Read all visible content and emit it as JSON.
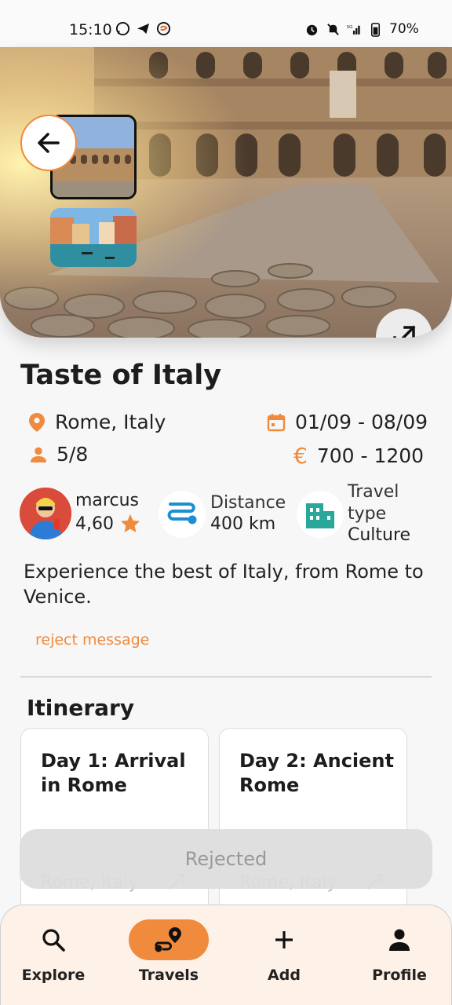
{
  "status_bar": {
    "time": "15:10",
    "battery": "70%",
    "network": "5G"
  },
  "hero": {
    "image_subject": "Colosseum, Rome",
    "thumbnails": [
      "Colosseum",
      "Venice canal"
    ]
  },
  "trip": {
    "title": "Taste of Italy",
    "location": "Rome, Italy",
    "dates": "01/09 - 08/09",
    "participants": "5/8",
    "price": "700 - 1200",
    "currency_symbol": "€",
    "description": "Experience the best of Italy, from Rome to Venice."
  },
  "owner": {
    "name": "marcus",
    "rating": "4,60"
  },
  "distance": {
    "label": "Distance",
    "value": "400 km"
  },
  "travel_type": {
    "label_line1": "Travel",
    "label_line2": "type",
    "value": "Culture"
  },
  "reject_message_link": "reject message",
  "itinerary": {
    "title": "Itinerary",
    "days": [
      {
        "title": "Day 1: Arrival in Rome",
        "location": "Rome, Italy"
      },
      {
        "title": "Day 2: Ancient Rome",
        "location": "Rome, Italy"
      }
    ]
  },
  "status_button": "Rejected",
  "bottom_nav": {
    "items": [
      {
        "label": "Explore",
        "icon": "search-icon"
      },
      {
        "label": "Travels",
        "icon": "route-icon",
        "active": true
      },
      {
        "label": "Add",
        "icon": "plus-icon"
      },
      {
        "label": "Profile",
        "icon": "person-icon"
      }
    ]
  },
  "colors": {
    "accent": "#f08a3c",
    "nav_background": "#fdf1e8",
    "teal": "#2aa79b",
    "blue": "#1a8fd1"
  }
}
